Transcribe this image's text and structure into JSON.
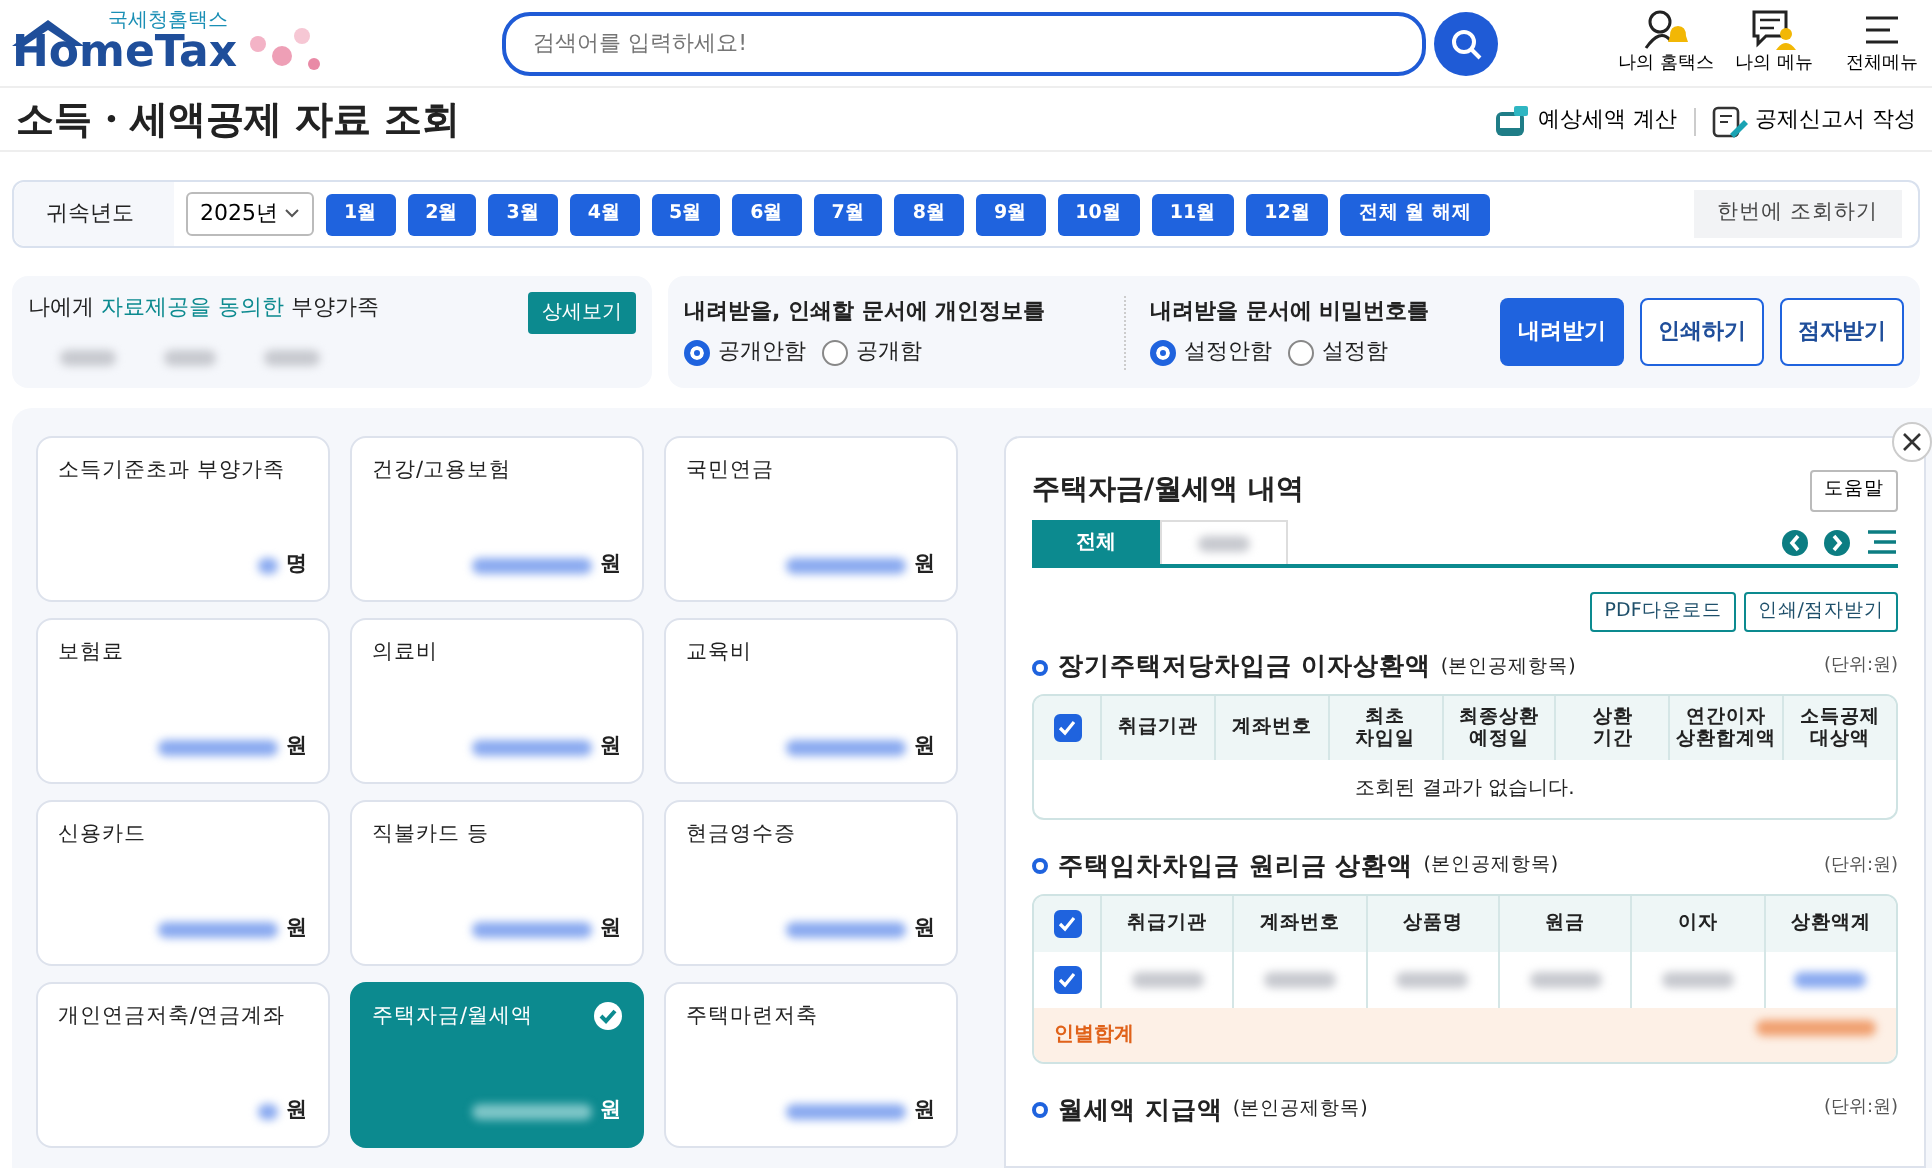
{
  "header": {
    "logo": {
      "subtitle": "국세청홈택스",
      "name": "HomeTax"
    },
    "search": {
      "placeholder": "검색어를 입력하세요!"
    },
    "nav_items": [
      {
        "label": "나의 홈택스",
        "kind": "person"
      },
      {
        "label": "나의 메뉴",
        "kind": "menu-person"
      },
      {
        "label": "전체메뉴",
        "kind": "hamburger"
      }
    ]
  },
  "page_title": "소득・세액공제 자료 조회",
  "title_actions": [
    {
      "label": "예상세액 계산",
      "kind": "calculator"
    },
    {
      "label": "공제신고서 작성",
      "kind": "form"
    }
  ],
  "filter": {
    "label": "귀속년도",
    "year": "2025년",
    "months": [
      {
        "label": "1월",
        "selected": true
      },
      {
        "label": "2월",
        "selected": true
      },
      {
        "label": "3월",
        "selected": true
      },
      {
        "label": "4월",
        "selected": true
      },
      {
        "label": "5월",
        "selected": true
      },
      {
        "label": "6월",
        "selected": true
      },
      {
        "label": "7월",
        "selected": true
      },
      {
        "label": "8월",
        "selected": true
      },
      {
        "label": "9월",
        "selected": true
      },
      {
        "label": "10월",
        "selected": true
      },
      {
        "label": "11월",
        "selected": true
      },
      {
        "label": "12월",
        "selected": true
      }
    ],
    "clear_button": "전체 월 해제",
    "query_button": "한번에 조회하기"
  },
  "consent": {
    "title": "나에게 **자료제공을 동의한** 부양가족",
    "detail_button": "상세보기"
  },
  "options": [
    {
      "question": "내려받을, 인쇄할 문서에 개인정보를",
      "choices": [
        {
          "label": "공개안함",
          "selected": true
        },
        {
          "label": "공개함",
          "selected": false
        }
      ]
    },
    {
      "question": "내려받을 문서에 비밀번호를",
      "choices": [
        {
          "label": "설정안함",
          "selected": true
        },
        {
          "label": "설정함",
          "selected": false
        }
      ]
    }
  ],
  "action_buttons": [
    {
      "label": "내려받기",
      "kind": "primary"
    },
    {
      "label": "인쇄하기",
      "kind": "outline"
    },
    {
      "label": "점자받기",
      "kind": "outline"
    }
  ],
  "cards": [
    {
      "title": "소득기준초과 부양가족",
      "unit": "명",
      "selected": false
    },
    {
      "title": "건강/고용보험",
      "unit": "원",
      "selected": false
    },
    {
      "title": "국민연금",
      "unit": "원",
      "selected": false
    },
    {
      "title": "보험료",
      "unit": "원",
      "selected": false
    },
    {
      "title": "의료비",
      "unit": "원",
      "selected": false
    },
    {
      "title": "교육비",
      "unit": "원",
      "selected": false
    },
    {
      "title": "신용카드",
      "unit": "원",
      "selected": false
    },
    {
      "title": "직불카드 등",
      "unit": "원",
      "selected": false
    },
    {
      "title": "현금영수증",
      "unit": "원",
      "selected": false
    },
    {
      "title": "개인연금저축/연금계좌",
      "unit": "원",
      "selected": false
    },
    {
      "title": "주택자금/월세액",
      "unit": "원",
      "selected": true
    },
    {
      "title": "주택마련저축",
      "unit": "원",
      "selected": false
    }
  ],
  "detail": {
    "title": "주택자금/월세액 내역",
    "help_button": "도움말",
    "tabs": [
      {
        "label": "전체",
        "selected": true
      }
    ],
    "buttons": [
      "PDF다운로드",
      "인쇄/점자받기"
    ],
    "sections": [
      {
        "title": "장기주택저당차입금 이자상환액",
        "note": "(본인공제항목)",
        "unit": "(단위:원)",
        "header_checked": true,
        "columns": [
          "취급기관",
          "계좌번호",
          "최초\n차입일",
          "최종상환\n예정일",
          "상환\n기간",
          "연간이자\n상환합계액",
          "소득공제\n대상액"
        ],
        "empty_message": "조회된 결과가 없습니다."
      },
      {
        "title": "주택임차차입금 원리금 상환액",
        "note": "(본인공제항목)",
        "unit": "(단위:원)",
        "header_checked": true,
        "columns": [
          "취급기관",
          "계좌번호",
          "상품명",
          "원금",
          "이자",
          "상환액계"
        ],
        "rows": [
          {
            "checked": true
          }
        ],
        "subtotal_label": "인별합계"
      },
      {
        "title": "월세액 지급액",
        "note": "(본인공제항목)",
        "unit": "(단위:원)"
      }
    ]
  }
}
